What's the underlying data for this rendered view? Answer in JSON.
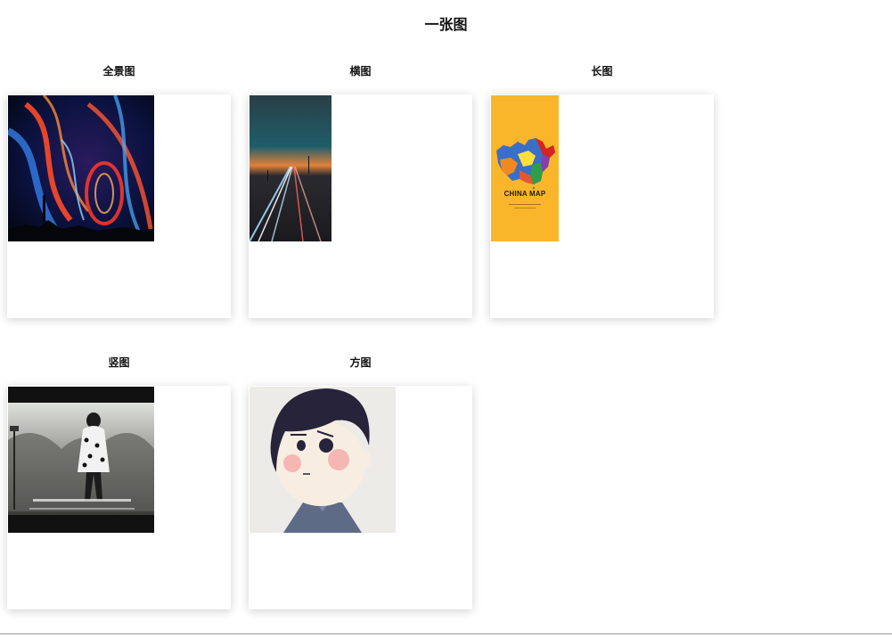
{
  "page": {
    "title": "一张图"
  },
  "sections": [
    {
      "label": "全景图",
      "image": "nebula-landscape-image"
    },
    {
      "label": "横图",
      "image": "night-highway-image"
    },
    {
      "label": "长图",
      "image": "china-map-poster-image"
    },
    {
      "label": "竖图",
      "image": "girl-walking-bw-image"
    },
    {
      "label": "方图",
      "image": "cartoon-boy-image"
    }
  ],
  "poster": {
    "text": "CHINA MAP"
  },
  "colors": {
    "map_bg": "#f9b62a",
    "card_bg": "#ffffff"
  }
}
